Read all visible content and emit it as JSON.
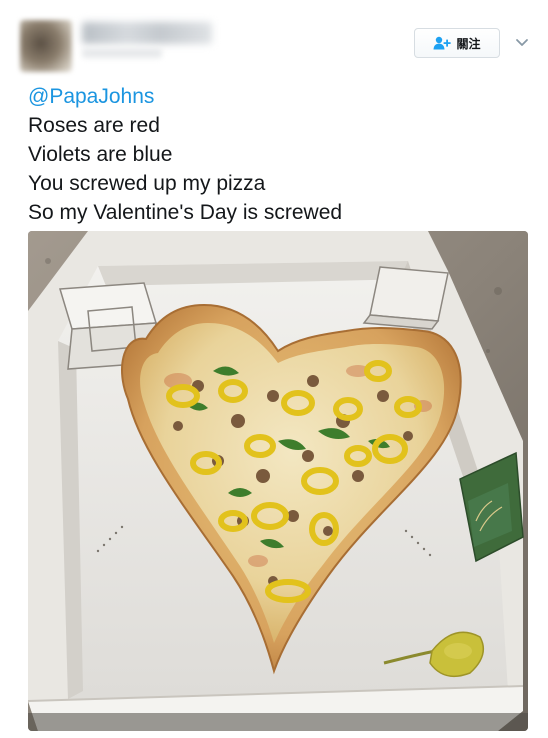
{
  "header": {
    "follow_label": "關注"
  },
  "tweet": {
    "mention": "@PapaJohns",
    "lines": [
      "Roses are red",
      "Violets are blue",
      "You screwed up my pizza",
      "So my Valentine's Day is screwed"
    ]
  },
  "icons": {
    "follow": "add-user-icon",
    "more": "chevron-down-icon"
  },
  "colors": {
    "mention": "#1b95e0",
    "follow_icon": "#1da1f2",
    "text": "#14171a"
  }
}
